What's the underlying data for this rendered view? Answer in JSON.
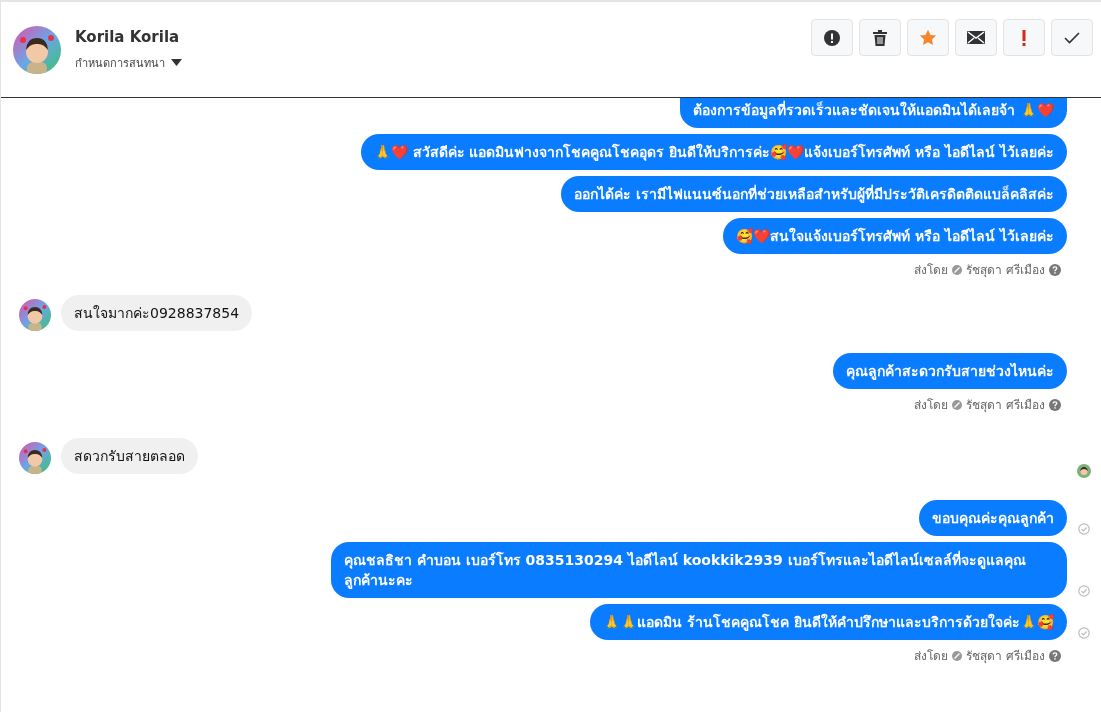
{
  "header": {
    "name": "Korila Korila",
    "subtitle": "กำหนดการสนทนา"
  },
  "actions": [
    {
      "kind": "alert"
    },
    {
      "kind": "delete"
    },
    {
      "kind": "star"
    },
    {
      "kind": "mail"
    },
    {
      "kind": "important"
    },
    {
      "kind": "done"
    }
  ],
  "messages": [
    {
      "kind": "outgoing",
      "text": "ต้องการข้อมูลที่รวดเร็วและชัดเจนให้แอดมินได้เลยจ้า 🙏❤️",
      "delivered": false,
      "cut": true
    },
    {
      "kind": "outgoing",
      "text": "🙏❤️ สวัสดีค่ะ แอดมินฟางจากโชคคูณโชคอุดร ยินดีให้บริการค่ะ🥰❤️แจ้งเบอร์โทรศัพท์ หรือ ไอดีไลน์  ไว้เลยค่ะ",
      "delivered": false
    },
    {
      "kind": "outgoing",
      "text": "ออกได้ค่ะ เรามีไฟแนนซ์นอกที่ช่วยเหลือสำหรับผู้ที่มีประวัติเครดิตติดแบล็คลิสค่ะ",
      "delivered": false
    },
    {
      "kind": "outgoing",
      "text": "🥰❤️สนใจแจ้งเบอร์โทรศัพท์ หรือ ไอดีไลน์  ไว้เลยค่ะ",
      "delivered": false
    },
    {
      "kind": "sent_by",
      "label": "ส่งโดย",
      "name": "รัชสุดา ศรีเมือง"
    },
    {
      "kind": "incoming",
      "text": "สนใจมากค่ะ0928837854",
      "seen": false
    },
    {
      "kind": "outgoing",
      "text": "คุณลูกค้าสะดวกรับสายช่วงไหนค่ะ",
      "delivered": false
    },
    {
      "kind": "sent_by",
      "label": "ส่งโดย",
      "name": "รัชสุดา ศรีเมือง"
    },
    {
      "kind": "incoming",
      "text": "สดวกรับสายตลอด",
      "seen": true
    },
    {
      "kind": "outgoing",
      "text": "ขอบคุณค่ะคุณลูกค้า",
      "delivered": true
    },
    {
      "kind": "outgoing",
      "text": "คุณชลธิชา คำบอน เบอร์โทร 0835130294  ไอดีไลน์ kookkik2939   เบอร์โทรและไอดีไลน์เซลล์ที่จะดูแลคุณลูกค้านะคะ",
      "delivered": true
    },
    {
      "kind": "outgoing",
      "text": "🙏🙏แอดมิน ร้านโชคคูณโชค ยินดีให้คำปรึกษาและบริการด้วยใจค่ะ🙏🥰",
      "delivered": true
    },
    {
      "kind": "sent_by",
      "label": "ส่งโดย",
      "name": "รัชสุดา ศรีเมือง"
    }
  ]
}
